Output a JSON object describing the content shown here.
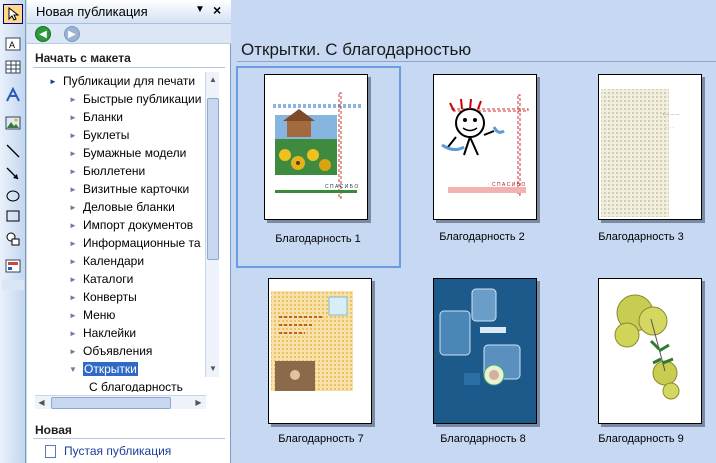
{
  "pane": {
    "title": "Новая публикация",
    "section_start": "Начать с макета",
    "section_new": "Новая",
    "tree_root": "Публикации для печати",
    "tree_items": [
      "Быстрые публикации",
      "Бланки",
      "Буклеты",
      "Бумажные модели",
      "Бюллетени",
      "Визитные карточки",
      "Деловые бланки",
      "Импорт документов",
      "Информационные та",
      "Календари",
      "Каталоги",
      "Конверты",
      "Меню",
      "Наклейки",
      "Объявления",
      "Открытки"
    ],
    "tree_subitem": "С благодарность",
    "selected_item": "Открытки",
    "new_blank": "Пустая публикация"
  },
  "main": {
    "title": "Открытки. С благодарностью",
    "cards": [
      {
        "label": "Благодарность  1"
      },
      {
        "label": "Благодарность  2"
      },
      {
        "label": "Благодарность  3"
      },
      {
        "label": "Благодарность  7"
      },
      {
        "label": "Благодарность  8"
      },
      {
        "label": "Благодарность  9"
      }
    ]
  },
  "colors": {
    "selection": "#316ac5",
    "card_selected_border": "#6b9ee0",
    "main_bg": "#c7d9f2"
  }
}
